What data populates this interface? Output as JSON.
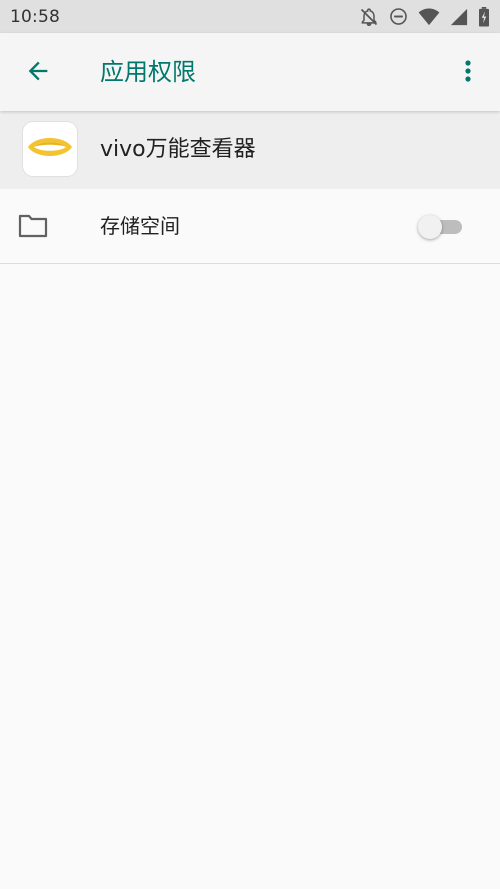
{
  "status_bar": {
    "time": "10:58",
    "icons": [
      "notifications-off-icon",
      "do-not-disturb-icon",
      "wifi-icon",
      "signal-icon",
      "battery-charging-icon"
    ]
  },
  "app_bar": {
    "back_icon": "arrow-back-icon",
    "title": "应用权限",
    "overflow_icon": "more-vert-icon",
    "accent_color": "#00796b"
  },
  "app_info": {
    "name": "vivo万能查看器",
    "icon": "eye-logo-icon",
    "icon_color": "#f4c430"
  },
  "permissions": [
    {
      "label": "存储空间",
      "icon": "folder-icon",
      "enabled": false
    }
  ]
}
